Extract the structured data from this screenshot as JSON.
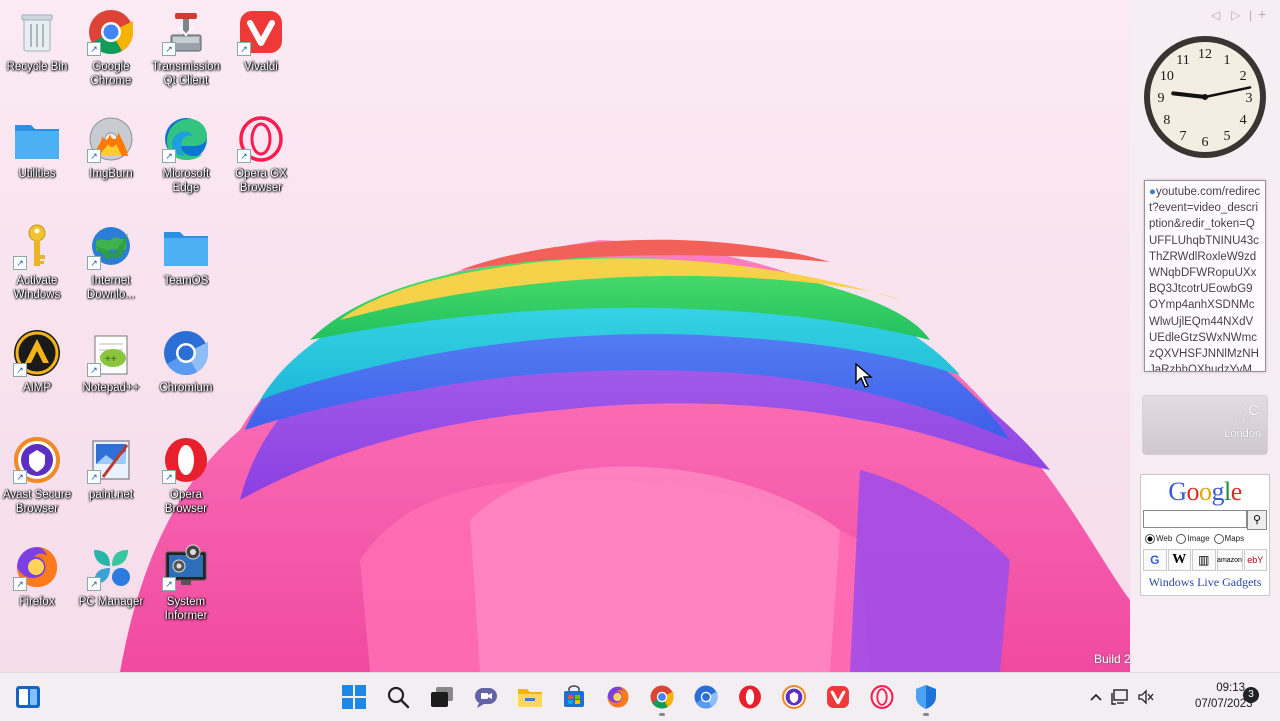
{
  "desktop": {
    "icons": [
      {
        "label": "Recycle Bin"
      },
      {
        "label": "Google Chrome"
      },
      {
        "label": "Transmission Qt Client"
      },
      {
        "label": "Vivaldi"
      },
      {
        "label": "Utilities"
      },
      {
        "label": "ImgBurn"
      },
      {
        "label": "Microsoft Edge"
      },
      {
        "label": "Opera GX Browser"
      },
      {
        "label": "Activate Windows"
      },
      {
        "label": "Internet Downlo..."
      },
      {
        "label": "TeamOS"
      },
      {
        "label": "AIMP"
      },
      {
        "label": "Notepad++"
      },
      {
        "label": "Chromium"
      },
      {
        "label": "Avast Secure Browser"
      },
      {
        "label": "paint.net"
      },
      {
        "label": "Opera Browser"
      },
      {
        "label": "Firefox"
      },
      {
        "label": "PC Manager"
      },
      {
        "label": "System Informer"
      }
    ]
  },
  "gadgets": {
    "clock": {
      "numbers": [
        "12",
        "1",
        "2",
        "3",
        "4",
        "5",
        "6",
        "7",
        "8",
        "9",
        "10",
        "11"
      ],
      "hour": 9,
      "minute": 13
    },
    "feed": {
      "text": "youtube.com/redirect?event=video_description&redir_token=QUFFLUhqbTNINU43cThZRWdlRoxleW9zdWNqbDFWRopuUXxBQ3JtcotrUEowbG9OYmp4anhXSDNMcWlwUjlEQm44NXdVUEdleGtzSWxNWmczQXVHSFJNNlMzNHJaRzhhOXhudzYvMmsL"
    },
    "weather": {
      "temp": "°C",
      "range": "°/°",
      "city": "London"
    },
    "google": {
      "logo_letters": [
        {
          "c": "G",
          "color": "#3b5bd6"
        },
        {
          "c": "o",
          "color": "#d93025"
        },
        {
          "c": "o",
          "color": "#e8a400"
        },
        {
          "c": "g",
          "color": "#3b5bd6"
        },
        {
          "c": "l",
          "color": "#1e8e3e"
        },
        {
          "c": "e",
          "color": "#d93025"
        }
      ],
      "options": [
        "Web",
        "Image",
        "Maps"
      ],
      "services": [
        "G",
        "W",
        "▥",
        "amazon",
        "ebY"
      ],
      "link": "Windows Live Gadgets"
    }
  },
  "watermark": {
    "build": "Build 2"
  },
  "taskbar": {
    "time": "09:13",
    "date": "07/07/2023",
    "notifications": "3"
  }
}
